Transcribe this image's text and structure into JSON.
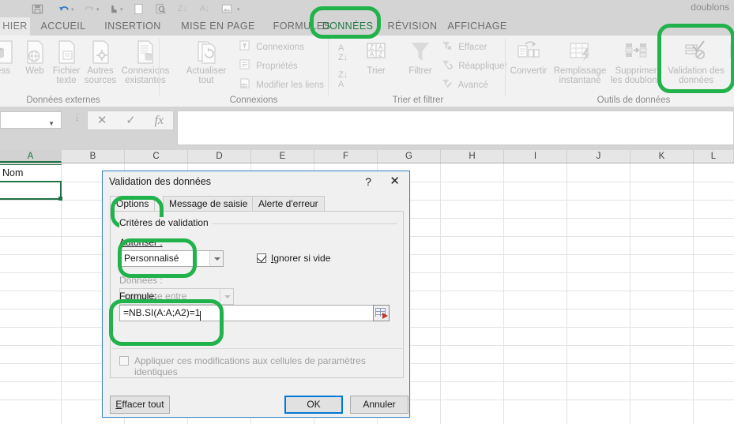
{
  "app": {
    "accent_green": "#217346",
    "annotation_green": "#22b24c",
    "focus_blue": "#0078d7"
  },
  "qat": {
    "icons": [
      "save-icon",
      "undo-icon",
      "redo-icon",
      "touch-mode-icon",
      "new-icon",
      "print-preview-icon",
      "sort-asc-icon",
      "sort-desc-icon",
      "picture-icon"
    ],
    "overflow_label": "doublons"
  },
  "ribbon": {
    "tabs": [
      {
        "label": "HIER",
        "active": false,
        "file": true
      },
      {
        "label": "ACCUEIL",
        "active": false
      },
      {
        "label": "INSERTION",
        "active": false
      },
      {
        "label": "MISE EN PAGE",
        "active": false
      },
      {
        "label": "FORMULES",
        "active": false
      },
      {
        "label": "DONNÉES",
        "active": true
      },
      {
        "label": "RÉVISION",
        "active": false
      },
      {
        "label": "AFFICHAGE",
        "active": false
      }
    ],
    "groups": [
      {
        "title": "Données externes",
        "buttons": [
          {
            "label": "ess",
            "icon": "access-database-icon"
          },
          {
            "label": "Web",
            "icon": "web-globe-icon"
          },
          {
            "label": "Fichier\ntexte",
            "line1": "Fichier",
            "line2": "texte",
            "icon": "text-file-icon"
          },
          {
            "label": "Autres\nsources",
            "line1": "Autres",
            "line2": "sources",
            "icon": "other-sources-icon",
            "dropdown": true
          },
          {
            "label": "Connexions\nexistantes",
            "line1": "Connexions",
            "line2": "existantes",
            "icon": "existing-connections-icon"
          }
        ]
      },
      {
        "title": "Connexions",
        "buttons": [
          {
            "line1": "Actualiser",
            "line2": "tout",
            "icon": "refresh-all-icon",
            "dropdown": true
          }
        ],
        "small_buttons": [
          {
            "label": "Connexions",
            "icon": "connections-icon"
          },
          {
            "label": "Propriétés",
            "icon": "properties-icon"
          },
          {
            "label": "Modifier les liens",
            "icon": "edit-links-icon"
          }
        ]
      },
      {
        "title": "Trier et filtrer",
        "buttons": [
          {
            "label": "Trier",
            "icon": "sort-dialog-icon"
          },
          {
            "label": "Filtrer",
            "icon": "filter-funnel-icon"
          }
        ],
        "mini_buttons": [
          {
            "icon": "sort-az-icon"
          },
          {
            "icon": "sort-za-icon"
          }
        ],
        "small_buttons": [
          {
            "label": "Effacer",
            "icon": "clear-filter-icon"
          },
          {
            "label": "Réappliquer",
            "icon": "reapply-filter-icon"
          },
          {
            "label": "Avancé",
            "icon": "advanced-filter-icon"
          }
        ]
      },
      {
        "title": "Outils de données",
        "buttons": [
          {
            "label": "Convertir",
            "icon": "text-to-columns-icon"
          },
          {
            "line1": "Remplissage",
            "line2": "instantané",
            "icon": "flash-fill-icon"
          },
          {
            "line1": "Supprimer",
            "line2": "les doublons",
            "icon": "remove-duplicates-icon"
          },
          {
            "line1": "Validation des",
            "line2": "données",
            "icon": "data-validation-icon",
            "dropdown": true,
            "highlighted": true
          }
        ]
      }
    ]
  },
  "formula_bar": {
    "name_box_value": "",
    "cancel_icon": "cancel-icon",
    "accept_icon": "accept-icon",
    "function_icon": "fx-icon",
    "value": ""
  },
  "sheet": {
    "columns": [
      "A",
      "B",
      "C",
      "D",
      "E",
      "F",
      "G",
      "H",
      "I",
      "J",
      "K",
      "L"
    ],
    "selected_column": "A",
    "cells": [
      {
        "ref": "A1",
        "value": "Nom"
      },
      {
        "ref": "A2",
        "value": ""
      }
    ],
    "active_cell": "A2"
  },
  "dialog": {
    "title": "Validation des données",
    "help_label": "?",
    "close_label": "✕",
    "tabs": [
      {
        "label": "Options",
        "selected": true,
        "highlighted": true
      },
      {
        "label": "Message de saisie",
        "selected": false
      },
      {
        "label": "Alerte d'erreur",
        "selected": false
      }
    ],
    "groupbox_label": "Critères de validation",
    "allow": {
      "label": "Autoriser :",
      "value": "Personnalisé",
      "highlighted": true
    },
    "ignore_blank": {
      "label": "Ignorer si vide",
      "checked": true
    },
    "data": {
      "label": "Données :",
      "value": "comprise entre",
      "disabled": true
    },
    "formula": {
      "label": "Formule:",
      "value": "=NB.SI(A:A;A2)=1",
      "highlighted": true,
      "range_picker_icon": "range-selector-icon"
    },
    "apply_all": {
      "label": "Appliquer ces modifications aux cellules de paramètres identiques",
      "checked": false,
      "disabled": true
    },
    "buttons": {
      "clear_all": "Effacer tout",
      "ok": "OK",
      "cancel": "Annuler"
    }
  },
  "annotations": [
    {
      "name": "annotation-donnees-tab"
    },
    {
      "name": "annotation-data-validation-button"
    },
    {
      "name": "annotation-options-tab"
    },
    {
      "name": "annotation-autoriser-combo"
    },
    {
      "name": "annotation-formule-field"
    }
  ]
}
